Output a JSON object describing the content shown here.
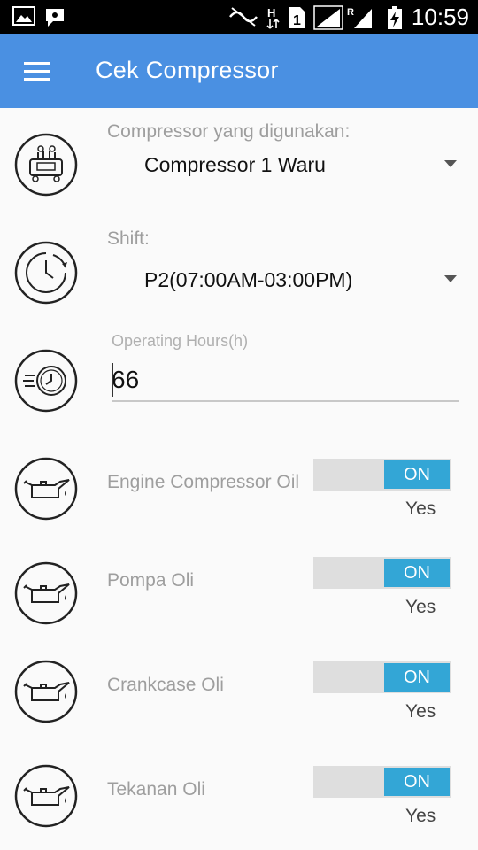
{
  "status_bar": {
    "time": "10:59",
    "icons": [
      "image-icon",
      "notification-icon",
      "nfc-icon",
      "h-signal-icon",
      "sim1-icon",
      "signal-icon",
      "roaming-signal-icon",
      "battery-charging-icon"
    ]
  },
  "app_bar": {
    "title": "Cek Compressor",
    "menu_icon": "hamburger-icon",
    "color": "#4a90e2"
  },
  "compressor": {
    "label": "Compressor yang digunakan:",
    "value": "Compressor 1 Waru",
    "icon": "compressor-icon"
  },
  "shift": {
    "label": "Shift:",
    "value": "P2(07:00AM-03:00PM)",
    "icon": "clock-icon"
  },
  "operating_hours": {
    "label": "Operating Hours(h)",
    "value": "66",
    "icon": "speedometer-clock-icon"
  },
  "checks": [
    {
      "label": "Engine Compressor Oil",
      "toggle": "ON",
      "status": "Yes",
      "icon": "oil-can-icon"
    },
    {
      "label": "Pompa Oli",
      "toggle": "ON",
      "status": "Yes",
      "icon": "oil-can-icon"
    },
    {
      "label": "Crankcase Oli",
      "toggle": "ON",
      "status": "Yes",
      "icon": "oil-can-icon"
    },
    {
      "label": "Tekanan Oli",
      "toggle": "ON",
      "status": "Yes",
      "icon": "oil-can-icon"
    }
  ],
  "colors": {
    "toggle_on": "#33a6d6",
    "toggle_track": "#dedede"
  }
}
